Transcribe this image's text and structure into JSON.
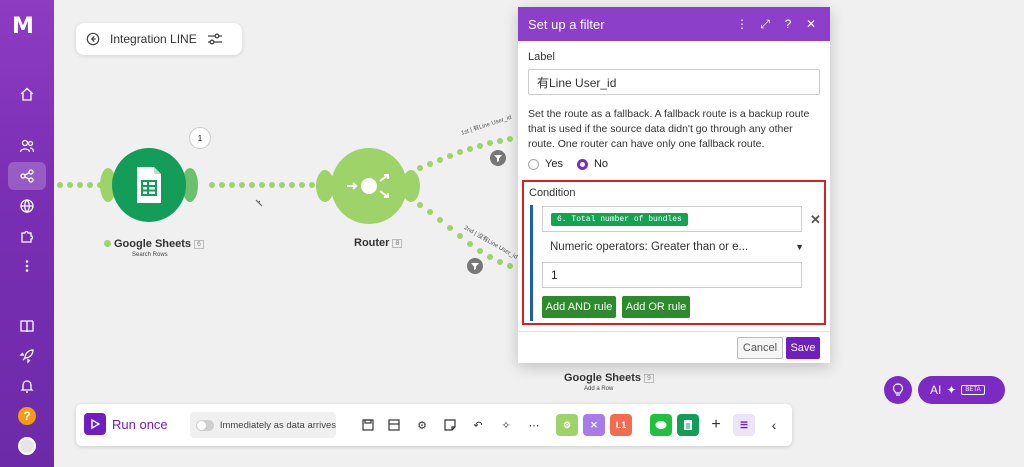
{
  "brand": {
    "logo_text": "M",
    "accent": "#7b2bc4"
  },
  "sidebar": {
    "items": [
      {
        "name": "home-icon"
      },
      {
        "name": "team-icon"
      },
      {
        "name": "share-icon"
      },
      {
        "name": "globe-icon"
      },
      {
        "name": "puzzle-icon"
      },
      {
        "name": "more-icon"
      },
      {
        "name": "book-icon"
      },
      {
        "name": "rocket-icon"
      },
      {
        "name": "bell-icon"
      }
    ],
    "help_label": "?"
  },
  "scenario": {
    "title": "Integration LINE"
  },
  "nodes": {
    "google_sheets": {
      "name": "Google Sheets",
      "num": "6",
      "sub": "Search Rows",
      "bubble": "1"
    },
    "router": {
      "name": "Router",
      "num": "8"
    },
    "google_sheets_add": {
      "name": "Google Sheets",
      "num": "9",
      "sub": "Add a Row"
    }
  },
  "routes": {
    "first": "1st | 有Line User_id",
    "second": "2nd | 沒有Line User_id"
  },
  "dialog": {
    "title": "Set up a filter",
    "label_title": "Label",
    "label_value": "有Line User_id",
    "fallback_text": "Set the route as a fallback. A fallback route is a backup route that is used if the source data didn't go through any other route. One router can have only one fallback route.",
    "yes": "Yes",
    "no": "No",
    "condition_title": "Condition",
    "condition_pill": "6. Total number of bundles",
    "operator": "Numeric operators: Greater than or e...",
    "value": "1",
    "and_rule": "Add AND rule",
    "or_rule": "Add OR rule",
    "cancel": "Cancel",
    "save": "Save"
  },
  "toolbar": {
    "run_once": "Run once",
    "schedule": "Immediately as data arrives",
    "tile_labels": {
      "line": "L1"
    }
  },
  "ai": {
    "label": "AI",
    "badge": "BETA"
  }
}
